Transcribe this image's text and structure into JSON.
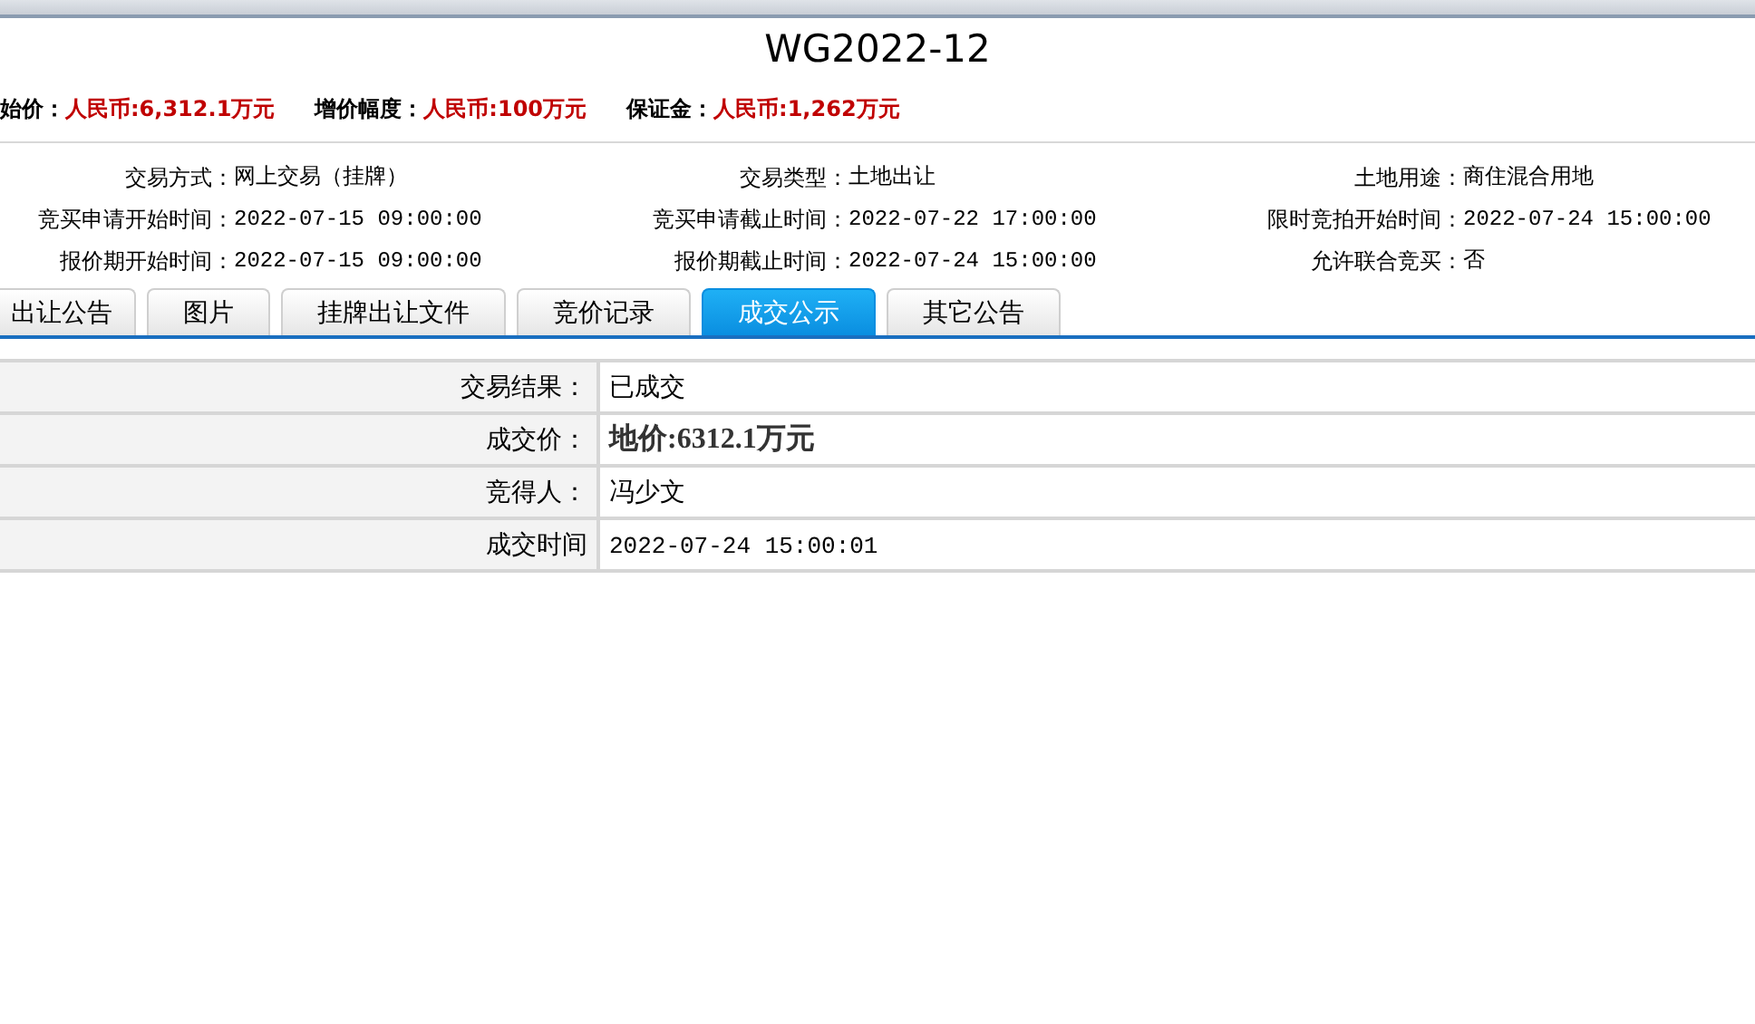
{
  "title": "WG2022-12",
  "price_terms": [
    {
      "label": "始价：",
      "value": "人民币:6,312.1万元"
    },
    {
      "label": "增价幅度：",
      "value": "人民币:100万元"
    },
    {
      "label": "保证金：",
      "value": "人民币:1,262万元"
    }
  ],
  "info": [
    {
      "label": "交易方式：",
      "value": "网上交易（挂牌）"
    },
    {
      "label": "交易类型：",
      "value": "土地出让"
    },
    {
      "label": "土地用途：",
      "value": "商住混合用地"
    },
    {
      "label": "竞买申请开始时间：",
      "value": "2022-07-15 09:00:00"
    },
    {
      "label": "竞买申请截止时间：",
      "value": "2022-07-22 17:00:00"
    },
    {
      "label": "限时竞拍开始时间：",
      "value": "2022-07-24 15:00:00"
    },
    {
      "label": "报价期开始时间：",
      "value": "2022-07-15 09:00:00"
    },
    {
      "label": "报价期截止时间：",
      "value": "2022-07-24 15:00:00"
    },
    {
      "label": "允许联合竞买：",
      "value": "否"
    }
  ],
  "tabs": [
    {
      "label": "出让公告",
      "selected": false
    },
    {
      "label": "图片",
      "selected": false
    },
    {
      "label": "挂牌出让文件",
      "selected": false
    },
    {
      "label": "竞价记录",
      "selected": false
    },
    {
      "label": "成交公示",
      "selected": true
    },
    {
      "label": "其它公告",
      "selected": false
    }
  ],
  "result": [
    {
      "label": "交易结果：",
      "value": "已成交",
      "kind": "text"
    },
    {
      "label": "成交价：",
      "value": "地价:6312.1万元",
      "kind": "price"
    },
    {
      "label": "竞得人：",
      "value": "冯少文",
      "kind": "text"
    },
    {
      "label": "成交时间",
      "value": "2022-07-24 15:00:01",
      "kind": "datetime"
    }
  ]
}
